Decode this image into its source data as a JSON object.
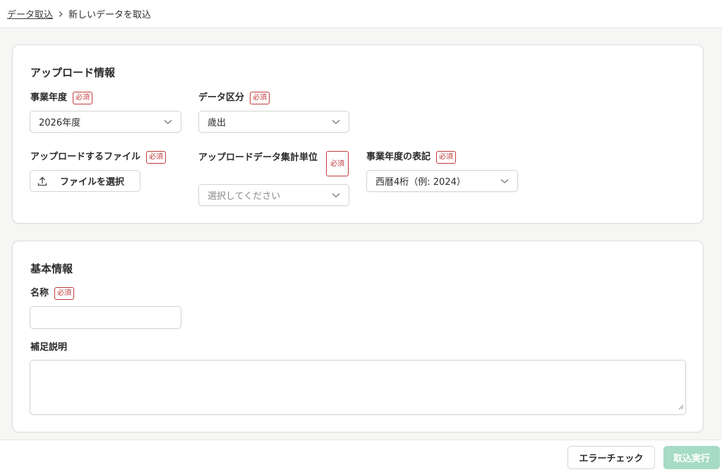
{
  "breadcrumb": {
    "parent": "データ取込",
    "current": "新しいデータを取込"
  },
  "upload_section": {
    "title": "アップロード情報",
    "required_label": "必須",
    "fiscal_year": {
      "label": "事業年度",
      "value": "2026年度"
    },
    "data_category": {
      "label": "データ区分",
      "value": "歳出"
    },
    "upload_file": {
      "label": "アップロードするファイル",
      "button": "ファイルを選択"
    },
    "aggregation_unit": {
      "label": "アップロードデータ集計単位",
      "placeholder": "選択してください"
    },
    "year_notation": {
      "label": "事業年度の表記",
      "value": "西暦4桁（例: 2024）"
    }
  },
  "basic_section": {
    "title": "基本情報",
    "required_label": "必須",
    "name": {
      "label": "名称",
      "value": ""
    },
    "description": {
      "label": "補足説明",
      "value": ""
    }
  },
  "footer": {
    "error_check_button": "エラーチェック",
    "import_button": "取込実行"
  },
  "colors": {
    "required_border": "#c23b3b",
    "primary_disabled": "#a6dbc6",
    "page_background": "#f6f6f5"
  }
}
